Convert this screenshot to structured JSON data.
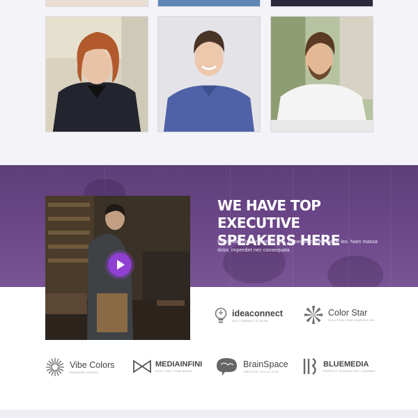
{
  "speakers": {
    "headline_line1": "WE HAVE TOP EXECUTIVE",
    "headline_line2": "SPEAKERS HERE",
    "description": "Proin ullamcorper pretium orci. Donec nec scelerisque leo. Nam massa dolor, imperdiet nec consequata.",
    "accent_color": "#8f3fd1",
    "band_color": "#6a4587"
  },
  "team_photos": [
    {
      "name": "speaker-photo-curly-hair"
    },
    {
      "name": "speaker-photo-blue-shirt"
    },
    {
      "name": "speaker-photo-white-shirt"
    }
  ],
  "logos": [
    {
      "name": "ideaconnect",
      "tagline": "any company slogan",
      "icon": "lightbulb-icon"
    },
    {
      "name": "Color Star",
      "tagline": "Solution Your Inspiration",
      "icon": "star-burst-icon"
    },
    {
      "name": "Vibe Colors",
      "tagline": "paradise design",
      "icon": "sunburst-icon"
    },
    {
      "name": "MEDIAINFINI",
      "tagline": "easy find your music",
      "icon": "bowtie-icon"
    },
    {
      "name": "BrainSpace",
      "tagline": "creative collective",
      "icon": "brain-icon"
    },
    {
      "name": "BLUEMEDIA",
      "tagline": "perfect technology company",
      "icon": "bars-icon"
    }
  ]
}
